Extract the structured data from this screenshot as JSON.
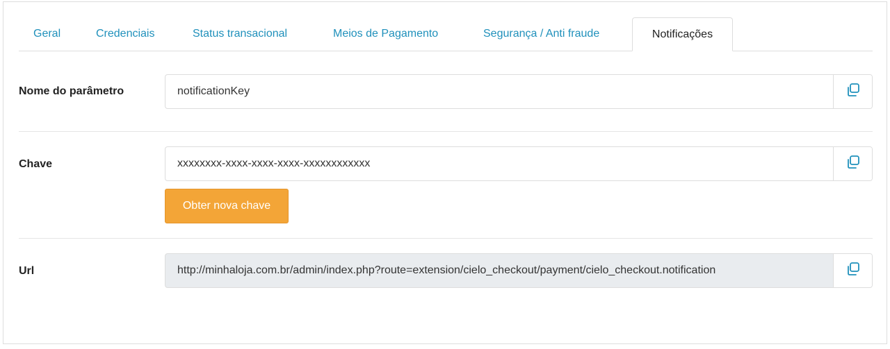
{
  "tabs": [
    {
      "label": "Geral",
      "active": false
    },
    {
      "label": "Credenciais",
      "active": false
    },
    {
      "label": "Status transacional",
      "active": false
    },
    {
      "label": "Meios de Pagamento",
      "active": false
    },
    {
      "label": "Segurança / Anti fraude",
      "active": false
    },
    {
      "label": "Notificações",
      "active": true
    }
  ],
  "form": {
    "param_name": {
      "label": "Nome do parâmetro",
      "value": "notificationKey",
      "copy_icon": "copy-icon"
    },
    "key": {
      "label": "Chave",
      "value": "xxxxxxxx-xxxx-xxxx-xxxx-xxxxxxxxxxxx",
      "copy_icon": "copy-icon",
      "new_key_button": "Obter nova chave"
    },
    "url": {
      "label": "Url",
      "value": "http://minhaloja.com.br/admin/index.php?route=extension/cielo_checkout/payment/cielo_checkout.notification",
      "readonly": true,
      "copy_icon": "copy-icon"
    }
  },
  "colors": {
    "link": "#1f90bb",
    "accent_button": "#f3a537",
    "readonly_bg": "#e9ecef",
    "border": "#dddddd"
  }
}
